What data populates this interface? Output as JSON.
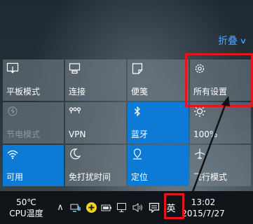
{
  "header": {
    "collapse_label": "折叠"
  },
  "tiles": [
    {
      "label": "平板模式",
      "icon": "tablet-mode-icon",
      "state": "normal"
    },
    {
      "label": "连接",
      "icon": "connect-icon",
      "state": "normal"
    },
    {
      "label": "便笺",
      "icon": "note-icon",
      "state": "normal"
    },
    {
      "label": "所有设置",
      "icon": "gear-icon",
      "state": "normal"
    },
    {
      "label": "节电模式",
      "icon": "battery-saver-icon",
      "state": "off"
    },
    {
      "label": "VPN",
      "icon": "vpn-icon",
      "state": "normal"
    },
    {
      "label": "蓝牙",
      "icon": "bluetooth-icon",
      "state": "on"
    },
    {
      "label": "100%",
      "icon": "brightness-icon",
      "state": "normal"
    },
    {
      "label": "可用",
      "icon": "wifi-icon",
      "state": "on"
    },
    {
      "label": "免打扰时间",
      "icon": "quiet-hours-icon",
      "state": "normal"
    },
    {
      "label": "定位",
      "icon": "location-icon",
      "state": "on"
    },
    {
      "label": "飞行模式",
      "icon": "airplane-icon",
      "state": "normal"
    }
  ],
  "taskbar": {
    "cpu_temp": "50℃",
    "cpu_label": "CPU温度",
    "ime": "英",
    "time": "13:02",
    "date": "2015/7/27"
  },
  "colors": {
    "accent": "#0d7bd6",
    "highlight": "#e8141d",
    "link": "#4fa3ff"
  }
}
